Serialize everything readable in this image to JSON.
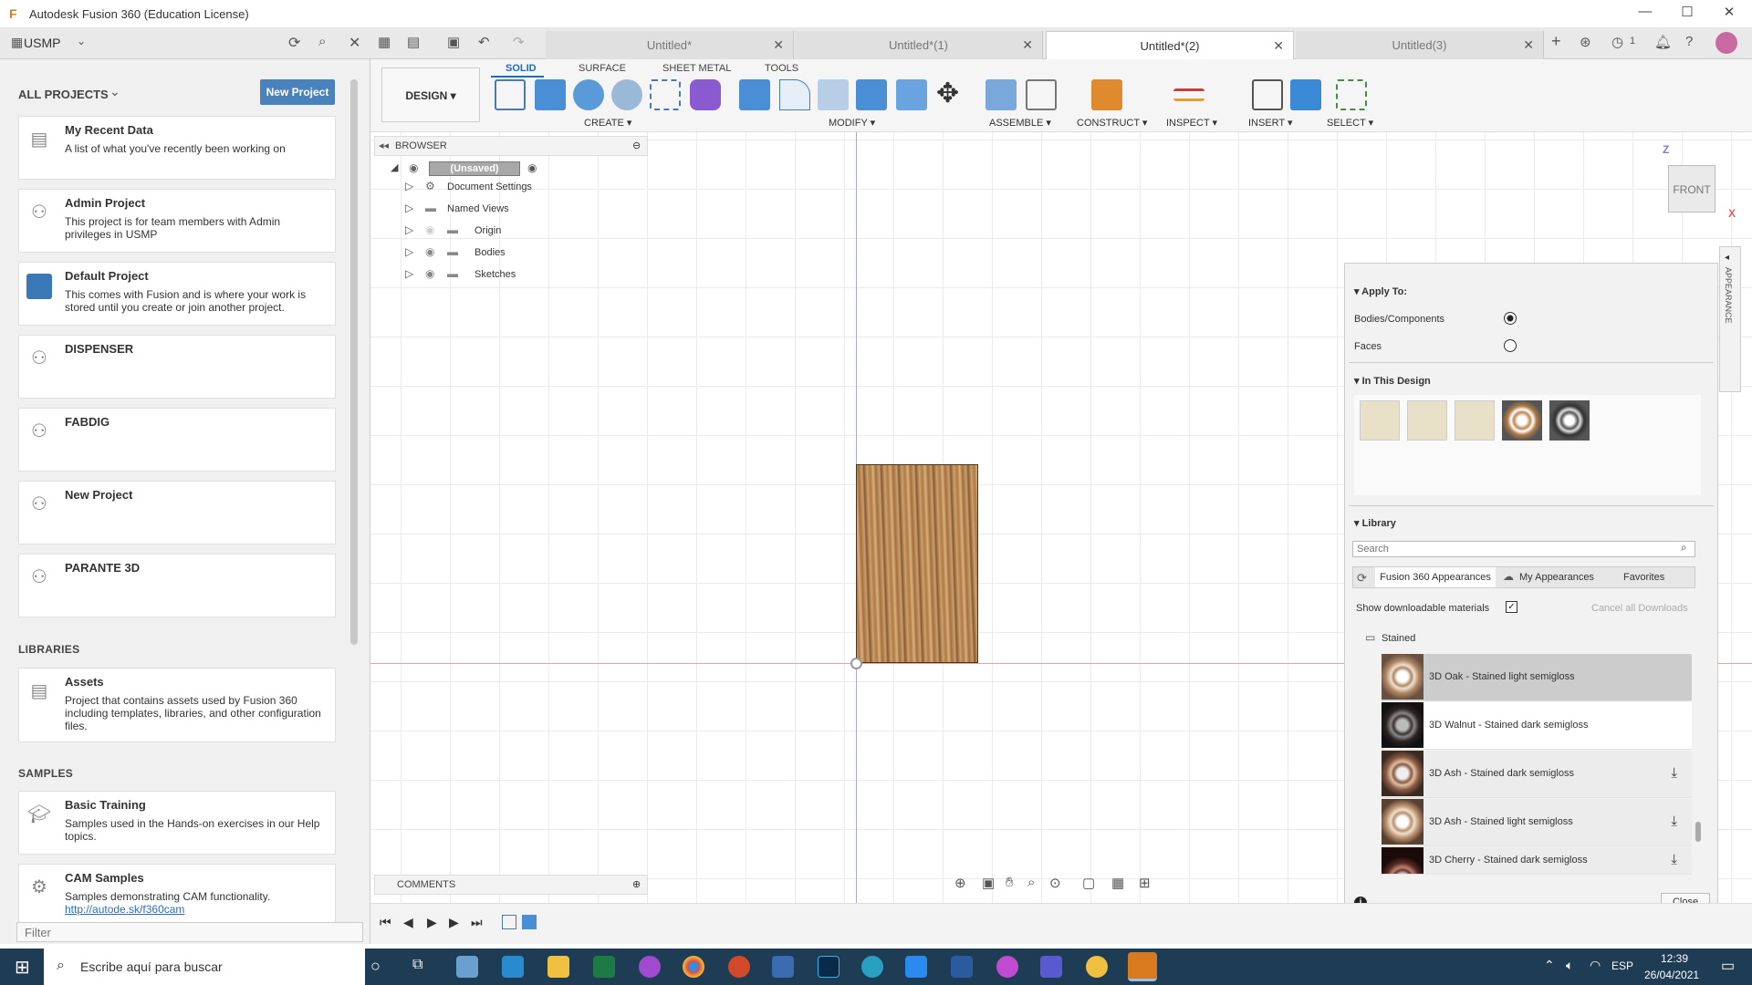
{
  "app": {
    "title": "Autodesk Fusion 360 (Education License)"
  },
  "team": {
    "name": "USMP"
  },
  "tabs": [
    {
      "label": "Untitled*"
    },
    {
      "label": "Untitled*(1)"
    },
    {
      "label": "Untitled*(2)"
    },
    {
      "label": "Untitled(3)"
    }
  ],
  "job_count": "1",
  "data_panel": {
    "all_projects": "ALL PROJECTS",
    "new_project_btn": "New Project",
    "projects": [
      {
        "name": "My Recent Data",
        "desc": "A list of what you've recently been working on",
        "icon": "document-icon"
      },
      {
        "name": "Admin Project",
        "desc": "This project is for team members with Admin privileges in USMP",
        "icon": "team-icon"
      },
      {
        "name": "Default Project",
        "desc": "This comes with Fusion and is where your work is stored until you create or join another project.",
        "icon": "project-thumbnail-icon"
      },
      {
        "name": "DISPENSER",
        "desc": "",
        "icon": "team-icon"
      },
      {
        "name": "FABDIG",
        "desc": "",
        "icon": "team-icon"
      },
      {
        "name": "New Project",
        "desc": "",
        "icon": "team-icon"
      },
      {
        "name": "PARANTE 3D",
        "desc": "",
        "icon": "team-icon"
      }
    ],
    "libraries_header": "LIBRARIES",
    "libraries": [
      {
        "name": "Assets",
        "desc": "Project that contains assets used by Fusion 360 including templates, libraries, and other configuration files.",
        "icon": "printer-icon"
      }
    ],
    "samples_header": "SAMPLES",
    "samples": [
      {
        "name": "Basic Training",
        "desc": "Samples used in the Hands-on exercises in our Help topics.",
        "icon": "graduation-cap-icon"
      },
      {
        "name": "CAM Samples",
        "desc": "Samples demonstrating CAM functionality.",
        "link": "http://autode.sk/f360cam",
        "icon": "cam-icon"
      }
    ],
    "filter_placeholder": "Filter"
  },
  "toolbar": {
    "workspace": "DESIGN ▾",
    "tabs": [
      "SOLID",
      "SURFACE",
      "SHEET METAL",
      "TOOLS"
    ],
    "groups": [
      "CREATE ▾",
      "MODIFY ▾",
      "ASSEMBLE ▾",
      "CONSTRUCT ▾",
      "INSPECT ▾",
      "INSERT ▾",
      "SELECT ▾"
    ]
  },
  "browser": {
    "title": "BROWSER",
    "root": "(Unsaved)",
    "items": [
      "Document Settings",
      "Named Views",
      "Origin",
      "Bodies",
      "Sketches"
    ]
  },
  "comments": "COMMENTS",
  "viewcube": {
    "face": "FRONT",
    "axis_z": "Z",
    "axis_x": "X"
  },
  "appearance": {
    "side_label": "APPEARANCE",
    "apply_to": "Apply To:",
    "option_bodies": "Bodies/Components",
    "option_faces": "Faces",
    "in_this_design": "In This Design",
    "library": "Library",
    "search_placeholder": "Search",
    "lib_tabs": [
      "Fusion 360 Appearances",
      "My Appearances",
      "Favorites"
    ],
    "show_downloadable": "Show downloadable materials",
    "cancel_downloads": "Cancel all Downloads",
    "folder": "Stained",
    "materials": [
      {
        "name": "3D Oak - Stained light semigloss",
        "color": "#b08866",
        "download": false
      },
      {
        "name": "3D Walnut - Stained dark semigloss",
        "color": "#3a3432",
        "download": false
      },
      {
        "name": "3D Ash - Stained dark semigloss",
        "color": "#8a5a44",
        "download": true
      },
      {
        "name": "3D Ash - Stained light semigloss",
        "color": "#b89070",
        "download": true
      },
      {
        "name": "3D Cherry - Stained dark semigloss",
        "color": "#6a3630",
        "download": true
      }
    ],
    "close_btn": "Close"
  },
  "taskbar": {
    "search_placeholder": "Escribe aquí para buscar",
    "lang": "ESP",
    "time": "12:39",
    "date": "26/04/2021"
  }
}
